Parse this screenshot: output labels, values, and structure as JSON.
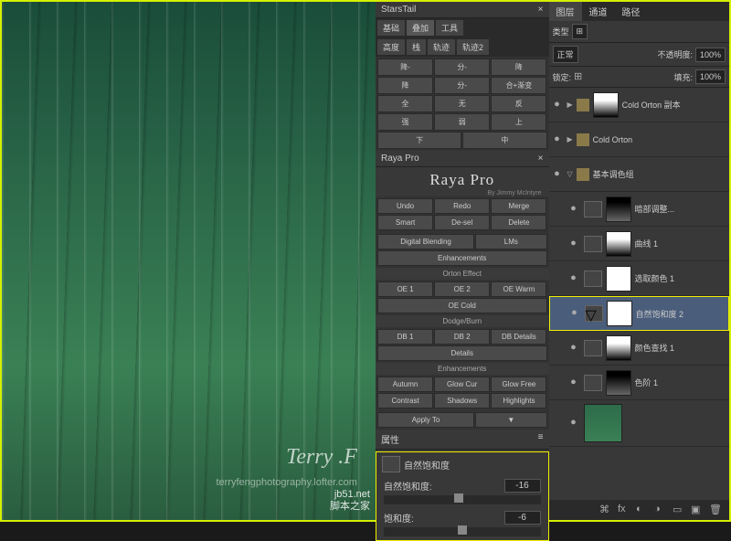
{
  "watermark": {
    "main": "Terry .F",
    "sub": "terryfengphotography.lofter.com",
    "site1": "jb51.net",
    "site2": "脚本之家"
  },
  "starstail": {
    "title": "StarsTail",
    "tabs": [
      "基础",
      "叠加",
      "工具"
    ],
    "row2": [
      "高度",
      "栈",
      "轨迹",
      "轨迹2"
    ],
    "grid": [
      "降-",
      "分-",
      "降",
      "降",
      "分-",
      "合+渐变",
      "全",
      "无",
      "反",
      "强",
      "弱",
      "上",
      "下",
      "中"
    ]
  },
  "raya": {
    "title": "Raya Pro",
    "panel_label": "Raya Pro",
    "by": "By Jimmy McIntyre",
    "row1": [
      "Undo",
      "Redo",
      "Merge",
      "Smart",
      "De-sel",
      "Delete"
    ],
    "row2": [
      "Digital Blending",
      "LMs",
      "Enhancements"
    ],
    "orton_label": "Orton Effect",
    "orton": [
      "OE 1",
      "OE 2",
      "OE Warm",
      "OE Cold"
    ],
    "dodge_label": "Dodge/Burn",
    "dodge": [
      "DB 1",
      "DB 2",
      "DB Details",
      "Details"
    ],
    "enh_label": "Enhancements",
    "enh1": [
      "Autumn",
      "Glow Cur",
      "Glow Free"
    ],
    "enh2": [
      "Contrast",
      "Shadows",
      "Highlights"
    ],
    "apply": "Apply To"
  },
  "props": {
    "title": "属性",
    "adj_name": "自然饱和度",
    "vibrance_label": "自然饱和度:",
    "vibrance_value": "-16",
    "saturation_label": "饱和度:",
    "saturation_value": "-6"
  },
  "layers": {
    "tabs": [
      "图层",
      "通道",
      "路径"
    ],
    "kind_label": "类型",
    "blend": "正常",
    "opacity_label": "不透明度:",
    "opacity": "100%",
    "lock_label": "锁定:",
    "fill_label": "填充:",
    "fill": "100%",
    "items": [
      {
        "name": "Cold Orton 副本",
        "type": "group"
      },
      {
        "name": "Cold Orton",
        "type": "group"
      },
      {
        "name": "基本调色组",
        "type": "group-open"
      },
      {
        "name": "暗部调整...",
        "type": "adj",
        "thumb": "dark"
      },
      {
        "name": "曲线 1",
        "type": "adj",
        "thumb": "mask"
      },
      {
        "name": "选取颜色 1",
        "type": "adj",
        "thumb": "white"
      },
      {
        "name": "自然饱和度 2",
        "type": "adj",
        "thumb": "white",
        "selected": true
      },
      {
        "name": "颜色查找 1",
        "type": "adj",
        "thumb": "mask"
      },
      {
        "name": "色阶 1",
        "type": "adj",
        "thumb": "dark"
      }
    ]
  }
}
